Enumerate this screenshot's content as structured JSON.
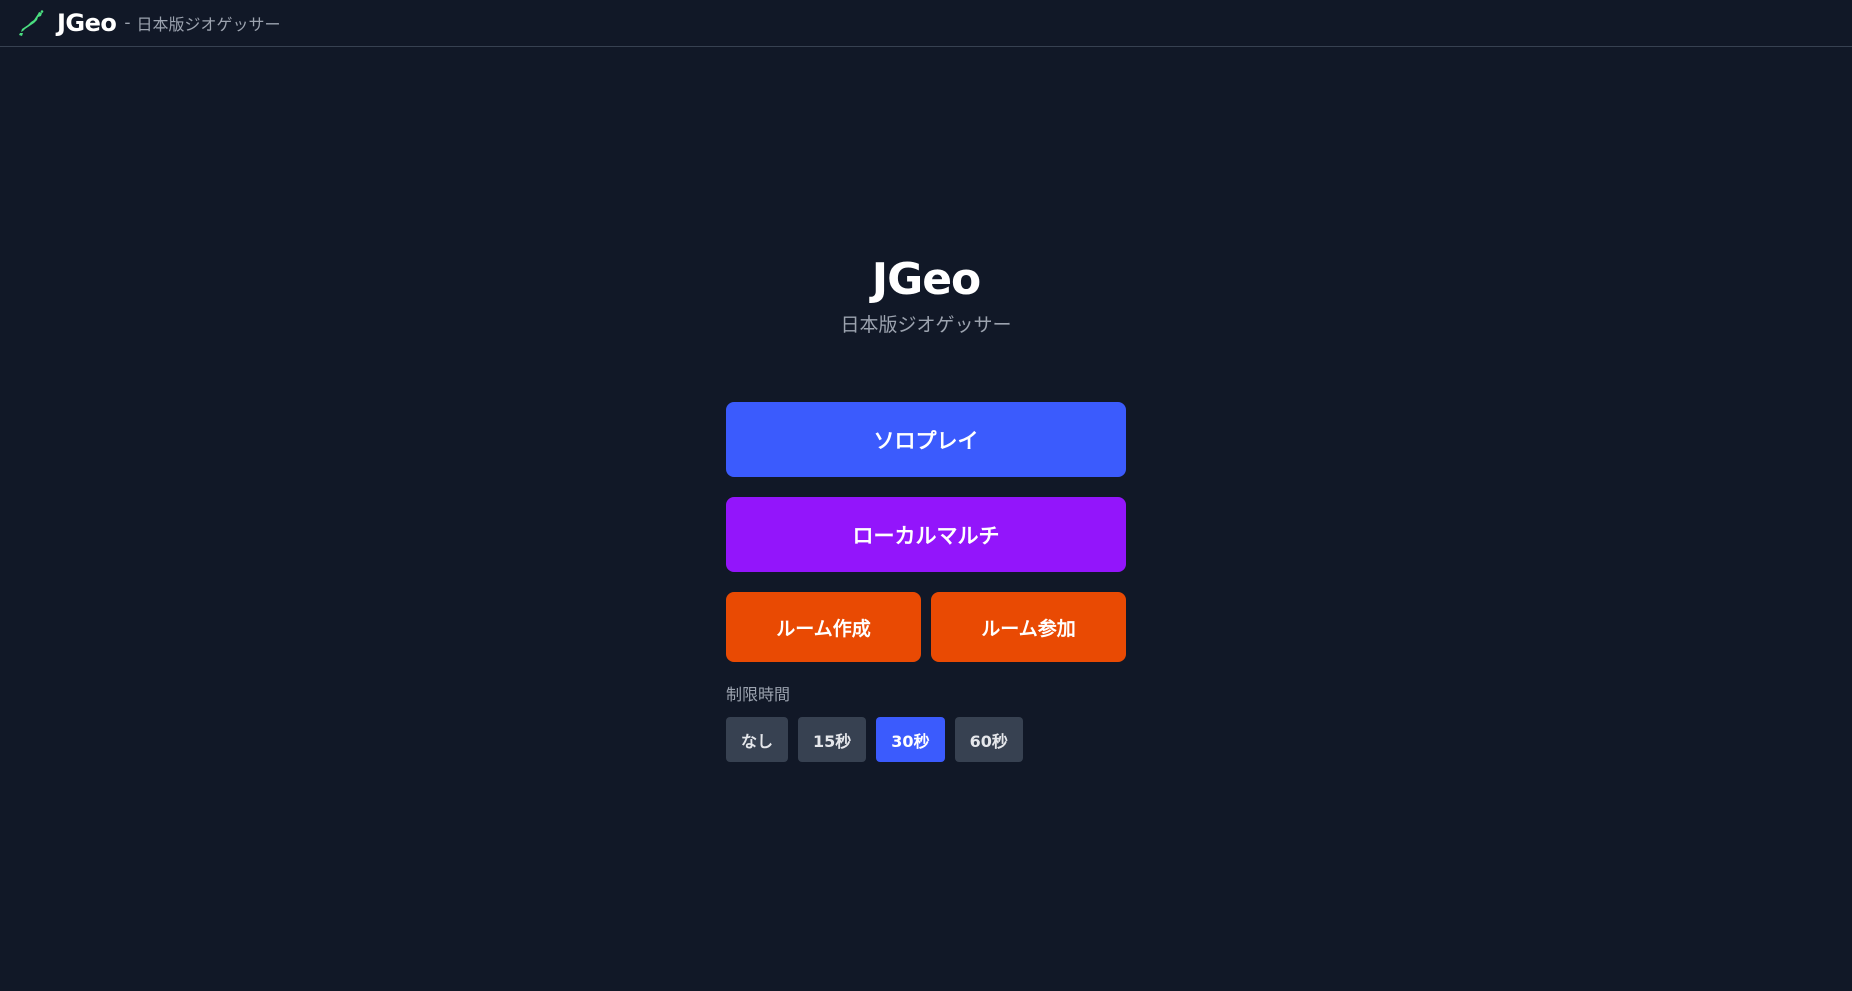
{
  "header": {
    "brand_name": "JGeo",
    "separator": "-",
    "subtitle": "日本版ジオゲッサー",
    "icon": "japan-map-icon"
  },
  "hero": {
    "title": "JGeo",
    "subtitle": "日本版ジオゲッサー"
  },
  "menu": {
    "solo_label": "ソロプレイ",
    "local_multi_label": "ローカルマルチ",
    "create_room_label": "ルーム作成",
    "join_room_label": "ルーム参加"
  },
  "time_limit": {
    "label": "制限時間",
    "options": [
      "なし",
      "15秒",
      "30秒",
      "60秒"
    ],
    "selected": "30秒"
  },
  "colors": {
    "background": "#111827",
    "solo": "#3b5bfd",
    "local_multi": "#9315fb",
    "room": "#e94a03",
    "option": "#374151",
    "option_active": "#3b5bfd",
    "icon_green": "#4ade80"
  }
}
